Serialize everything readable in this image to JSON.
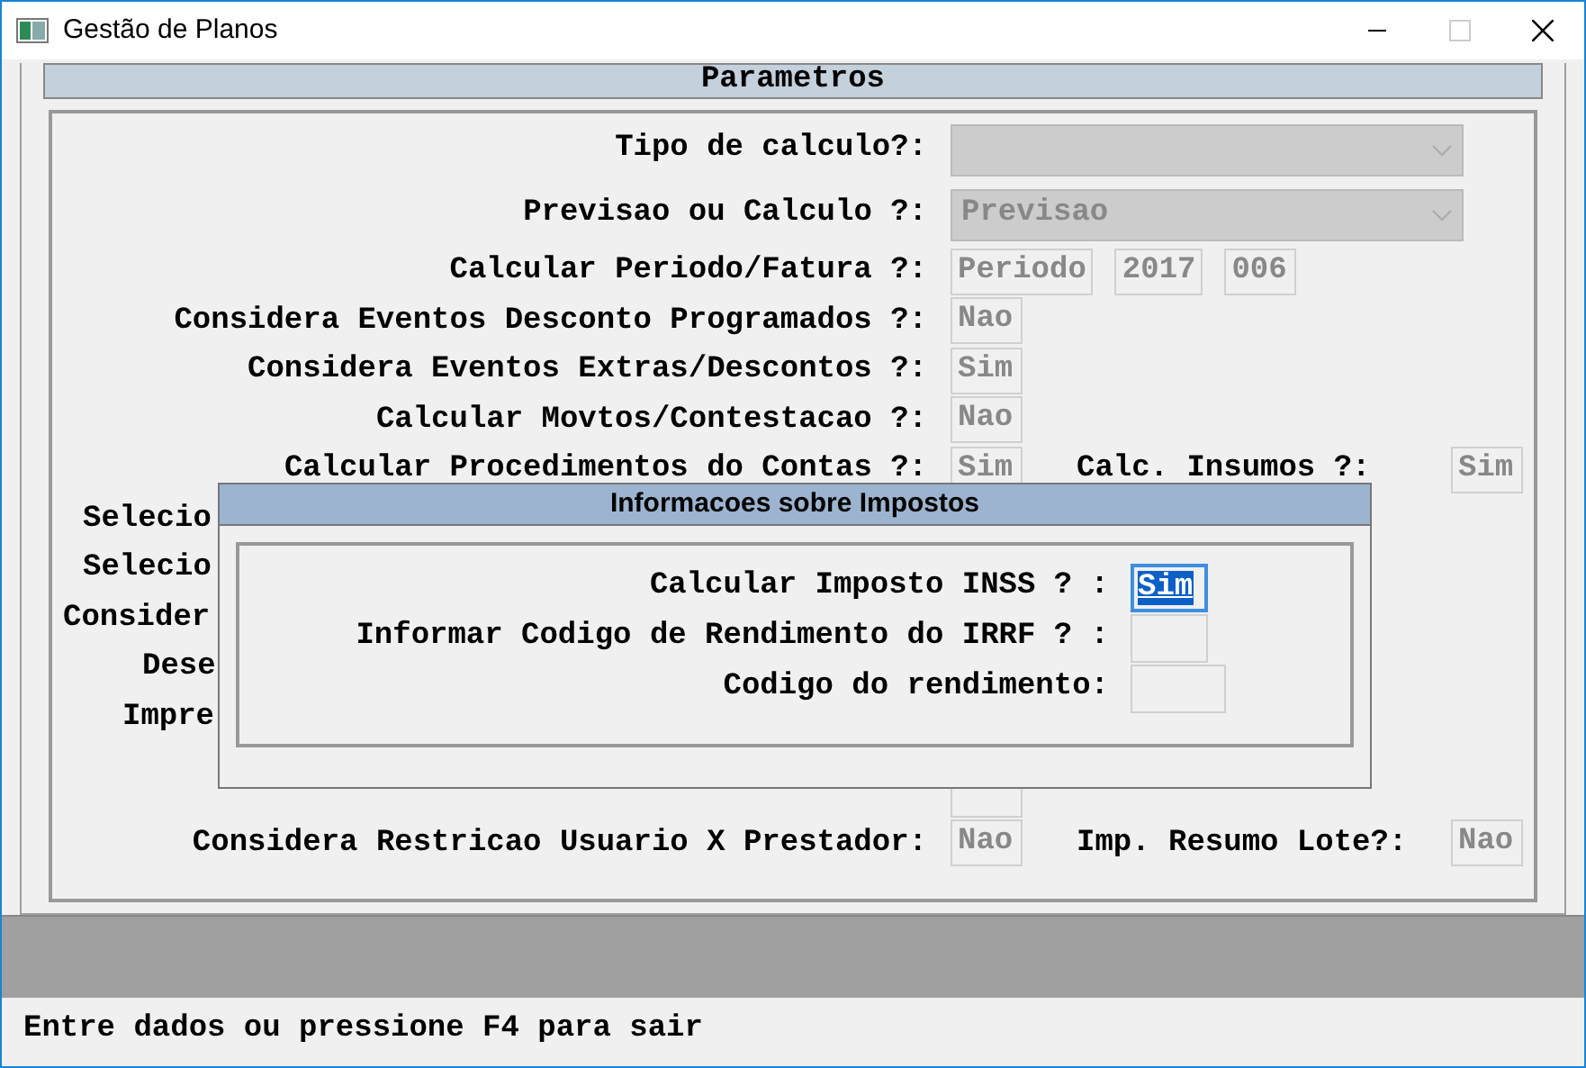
{
  "window": {
    "title": "Gestão de Planos"
  },
  "parameters": {
    "title": "Parametros",
    "rows": [
      {
        "label": "Tipo de calculo?:",
        "fields": [
          {
            "kind": "dropdown"
          }
        ]
      },
      {
        "label": "Previsao ou Calculo ?:",
        "fields": [
          {
            "kind": "dropdown",
            "value": "Previsao"
          }
        ]
      },
      {
        "label": "Calcular Periodo/Fatura ?:",
        "fields": [
          {
            "kind": "text",
            "value": "Periodo"
          },
          {
            "kind": "text",
            "value": "2017"
          },
          {
            "kind": "text",
            "value": "006"
          }
        ]
      },
      {
        "label": "Considera Eventos Desconto Programados ?:",
        "fields": [
          {
            "kind": "text",
            "value": "Nao"
          }
        ]
      },
      {
        "label": "Considera Eventos Extras/Descontos ?:",
        "fields": [
          {
            "kind": "text",
            "value": "Sim"
          }
        ]
      },
      {
        "label": "Calcular Movtos/Contestacao ?:",
        "fields": [
          {
            "kind": "text",
            "value": "Nao"
          }
        ]
      },
      {
        "label": "Calcular Procedimentos do Contas ?:",
        "fields": [
          {
            "kind": "text",
            "value": "Sim"
          }
        ],
        "extra": {
          "label": "Calc. Insumos ?:",
          "fields": [
            {
              "kind": "text",
              "value": "Sim"
            }
          ]
        }
      },
      {
        "label": "Selecio"
      },
      {
        "label": "Selecio"
      },
      {
        "label": "Consider"
      },
      {
        "label": "Dese"
      },
      {
        "label": "Impre"
      },
      {
        "fields": [
          {
            "kind": "text"
          }
        ]
      },
      {
        "label": "Considera Restricao Usuario X Prestador:",
        "fields": [
          {
            "kind": "text",
            "value": "Nao"
          }
        ],
        "extra": {
          "label": "Imp. Resumo Lote?:",
          "fields": [
            {
              "kind": "text",
              "value": "Nao"
            }
          ]
        }
      }
    ]
  },
  "dialog": {
    "title": "Informacoes sobre Impostos",
    "rows": [
      {
        "label": "Calcular Imposto INSS ? :",
        "field": {
          "value": "Sim",
          "selected": true
        }
      },
      {
        "label": "Informar Codigo de Rendimento do IRRF ? :",
        "field": {
          "selected": false
        }
      },
      {
        "label": "Codigo do rendimento:",
        "field": {
          "selected": false
        }
      }
    ]
  },
  "status_bar": "Entre dados ou pressione F4 para sair"
}
